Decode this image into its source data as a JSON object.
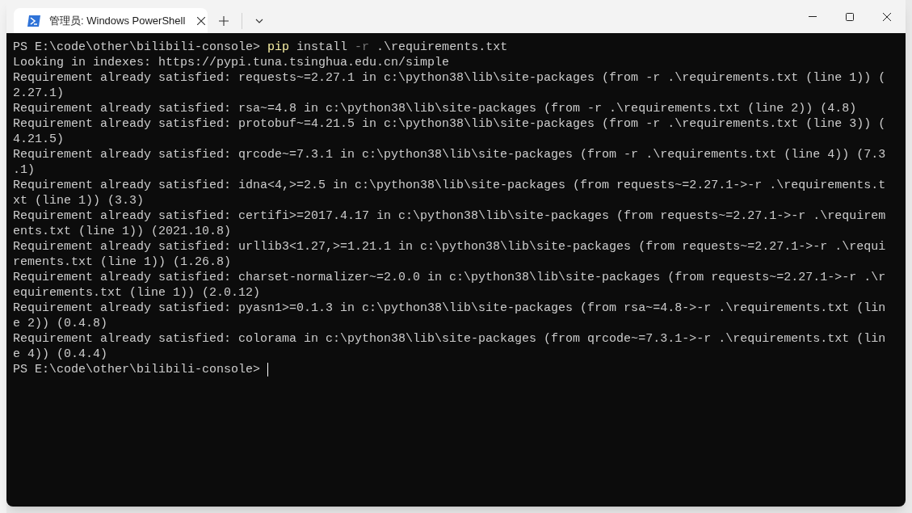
{
  "window": {
    "tab": {
      "title": "管理员: Windows PowerShell",
      "selected": true
    }
  },
  "terminal": {
    "lines": [
      {
        "segments": [
          {
            "kind": "prompt",
            "text": "PS E:\\code\\other\\bilibili-console> "
          },
          {
            "kind": "command",
            "text": "pip"
          },
          {
            "kind": "output",
            "text": " install "
          },
          {
            "kind": "parameter",
            "text": "-r"
          },
          {
            "kind": "output",
            "text": " .\\requirements.txt"
          }
        ]
      },
      {
        "segments": [
          {
            "kind": "output",
            "text": "Looking in indexes: https://pypi.tuna.tsinghua.edu.cn/simple"
          }
        ]
      },
      {
        "segments": [
          {
            "kind": "output",
            "text": "Requirement already satisfied: requests~=2.27.1 in c:\\python38\\lib\\site-packages (from -r .\\requirements.txt (line 1)) ("
          }
        ]
      },
      {
        "segments": [
          {
            "kind": "output",
            "text": "2.27.1)"
          }
        ]
      },
      {
        "segments": [
          {
            "kind": "output",
            "text": "Requirement already satisfied: rsa~=4.8 in c:\\python38\\lib\\site-packages (from -r .\\requirements.txt (line 2)) (4.8)"
          }
        ]
      },
      {
        "segments": [
          {
            "kind": "output",
            "text": "Requirement already satisfied: protobuf~=4.21.5 in c:\\python38\\lib\\site-packages (from -r .\\requirements.txt (line 3)) ("
          }
        ]
      },
      {
        "segments": [
          {
            "kind": "output",
            "text": "4.21.5)"
          }
        ]
      },
      {
        "segments": [
          {
            "kind": "output",
            "text": "Requirement already satisfied: qrcode~=7.3.1 in c:\\python38\\lib\\site-packages (from -r .\\requirements.txt (line 4)) (7.3"
          }
        ]
      },
      {
        "segments": [
          {
            "kind": "output",
            "text": ".1)"
          }
        ]
      },
      {
        "segments": [
          {
            "kind": "output",
            "text": "Requirement already satisfied: idna<4,>=2.5 in c:\\python38\\lib\\site-packages (from requests~=2.27.1->-r .\\requirements.t"
          }
        ]
      },
      {
        "segments": [
          {
            "kind": "output",
            "text": "xt (line 1)) (3.3)"
          }
        ]
      },
      {
        "segments": [
          {
            "kind": "output",
            "text": "Requirement already satisfied: certifi>=2017.4.17 in c:\\python38\\lib\\site-packages (from requests~=2.27.1->-r .\\requirem"
          }
        ]
      },
      {
        "segments": [
          {
            "kind": "output",
            "text": "ents.txt (line 1)) (2021.10.8)"
          }
        ]
      },
      {
        "segments": [
          {
            "kind": "output",
            "text": "Requirement already satisfied: urllib3<1.27,>=1.21.1 in c:\\python38\\lib\\site-packages (from requests~=2.27.1->-r .\\requi"
          }
        ]
      },
      {
        "segments": [
          {
            "kind": "output",
            "text": "rements.txt (line 1)) (1.26.8)"
          }
        ]
      },
      {
        "segments": [
          {
            "kind": "output",
            "text": "Requirement already satisfied: charset-normalizer~=2.0.0 in c:\\python38\\lib\\site-packages (from requests~=2.27.1->-r .\\r"
          }
        ]
      },
      {
        "segments": [
          {
            "kind": "output",
            "text": "equirements.txt (line 1)) (2.0.12)"
          }
        ]
      },
      {
        "segments": [
          {
            "kind": "output",
            "text": "Requirement already satisfied: pyasn1>=0.1.3 in c:\\python38\\lib\\site-packages (from rsa~=4.8->-r .\\requirements.txt (lin"
          }
        ]
      },
      {
        "segments": [
          {
            "kind": "output",
            "text": "e 2)) (0.4.8)"
          }
        ]
      },
      {
        "segments": [
          {
            "kind": "output",
            "text": "Requirement already satisfied: colorama in c:\\python38\\lib\\site-packages (from qrcode~=7.3.1->-r .\\requirements.txt (lin"
          }
        ]
      },
      {
        "segments": [
          {
            "kind": "output",
            "text": "e 4)) (0.4.4)"
          }
        ]
      },
      {
        "segments": [
          {
            "kind": "prompt",
            "text": "PS E:\\code\\other\\bilibili-console> "
          }
        ],
        "cursor": true
      }
    ]
  }
}
